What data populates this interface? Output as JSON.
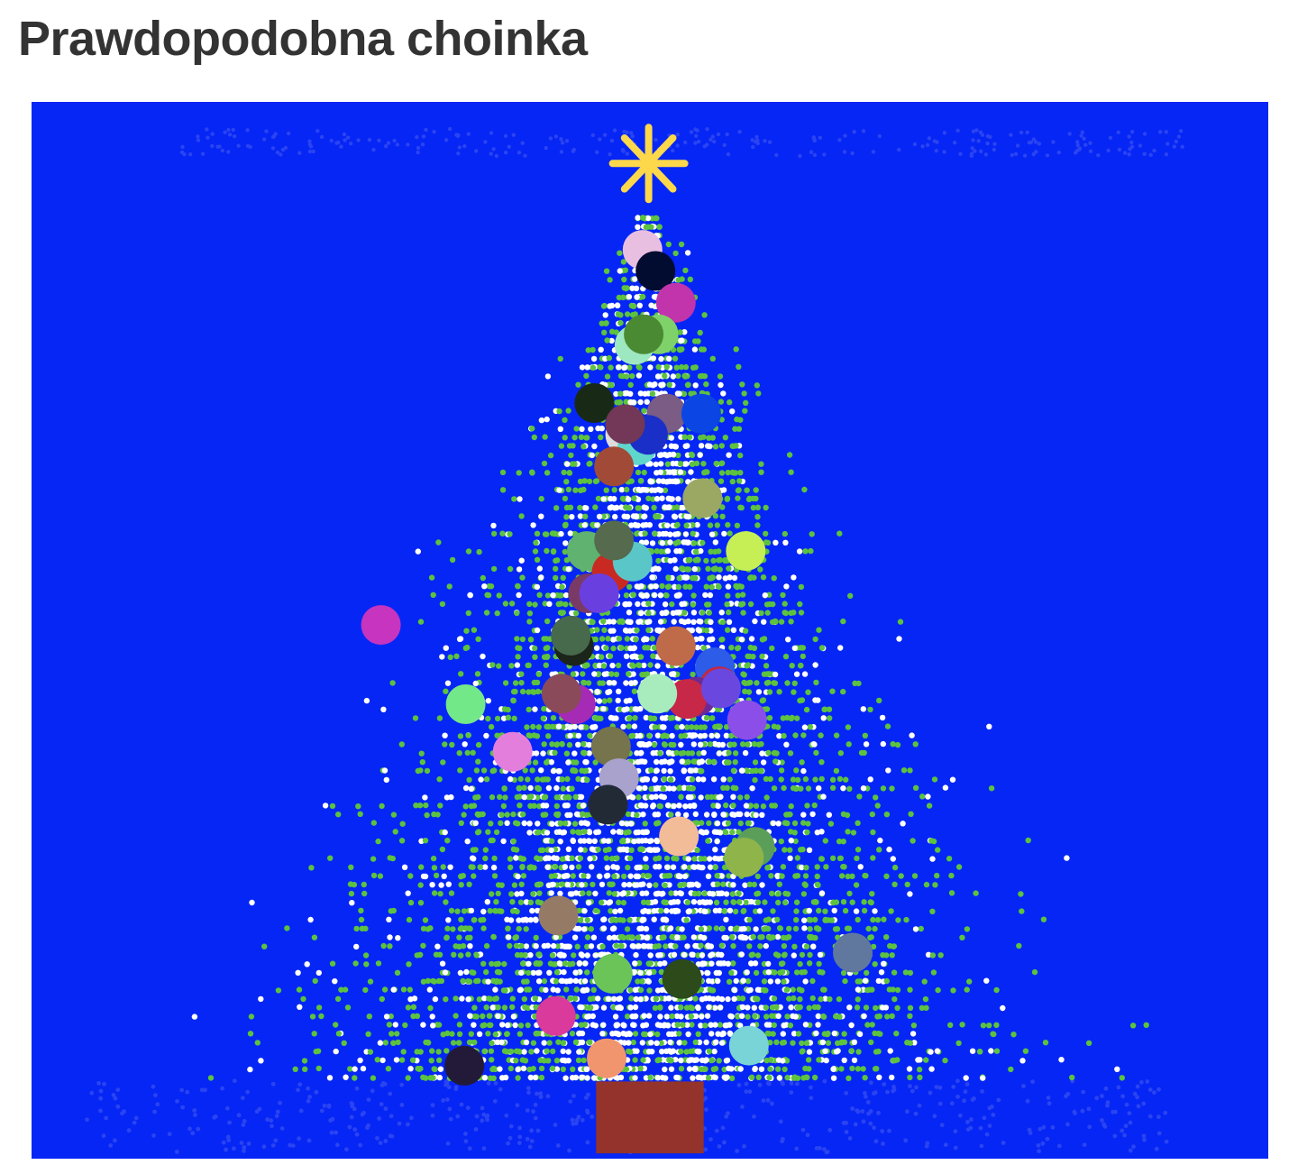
{
  "page": {
    "title": "Prawdopodobna choinka"
  },
  "chart_data": {
    "type": "scatter",
    "title": "Prawdopodobna choinka",
    "xlabel": "",
    "ylabel": "",
    "xlim": [
      -1,
      1
    ],
    "ylim": [
      0,
      1
    ],
    "grid": false,
    "axes_visible": false,
    "legend": "none",
    "colors": {
      "background": "#0626f5",
      "needles_green": "#5cc23f",
      "needles_white": "#ffffff",
      "snow_faint": "#2a44f2",
      "trunk": "#93332c",
      "star": "#fdd84a"
    },
    "tree": {
      "tip_y": 0.9,
      "base_y": 0.075,
      "half_width_at_base": 0.52,
      "spread": 0.9
    },
    "trunk": {
      "x": [
        -0.087,
        0.087
      ],
      "y": [
        0.005,
        0.073
      ]
    },
    "star": {
      "x": -0.002,
      "y": 0.94
    },
    "ornaments": [
      {
        "x": -0.012,
        "y": 0.86,
        "color": "#e8bfe0"
      },
      {
        "x": 0.009,
        "y": 0.84,
        "color": "#020b30"
      },
      {
        "x": 0.042,
        "y": 0.81,
        "color": "#c234ac"
      },
      {
        "x": 0.014,
        "y": 0.78,
        "color": "#7fd26a"
      },
      {
        "x": -0.025,
        "y": 0.77,
        "color": "#9de8c0"
      },
      {
        "x": -0.01,
        "y": 0.78,
        "color": "#4a8a32"
      },
      {
        "x": -0.09,
        "y": 0.715,
        "color": "#182a16"
      },
      {
        "x": 0.027,
        "y": 0.705,
        "color": "#7a5c84"
      },
      {
        "x": 0.083,
        "y": 0.705,
        "color": "#0b46e4"
      },
      {
        "x": -0.04,
        "y": 0.685,
        "color": "#dedcdc"
      },
      {
        "x": -0.02,
        "y": 0.675,
        "color": "#5fd6cc"
      },
      {
        "x": -0.003,
        "y": 0.685,
        "color": "#1a2ec8"
      },
      {
        "x": -0.04,
        "y": 0.695,
        "color": "#733757"
      },
      {
        "x": -0.058,
        "y": 0.655,
        "color": "#a24a38"
      },
      {
        "x": 0.085,
        "y": 0.625,
        "color": "#9aa864"
      },
      {
        "x": 0.155,
        "y": 0.575,
        "color": "#c6ef55"
      },
      {
        "x": -0.102,
        "y": 0.575,
        "color": "#5fb270"
      },
      {
        "x": -0.062,
        "y": 0.555,
        "color": "#c82a22"
      },
      {
        "x": -0.028,
        "y": 0.565,
        "color": "#5ac6c8"
      },
      {
        "x": -0.058,
        "y": 0.585,
        "color": "#566a4e"
      },
      {
        "x": -0.1,
        "y": 0.535,
        "color": "#7a3a66"
      },
      {
        "x": -0.082,
        "y": 0.535,
        "color": "#6a3fe0"
      },
      {
        "x": -0.123,
        "y": 0.485,
        "color": "#1b2519"
      },
      {
        "x": -0.128,
        "y": 0.495,
        "color": "#47694c"
      },
      {
        "x": 0.042,
        "y": 0.485,
        "color": "#bf6b4a"
      },
      {
        "x": 0.105,
        "y": 0.465,
        "color": "#2c5ce8"
      },
      {
        "x": 0.112,
        "y": 0.447,
        "color": "#c02a44"
      },
      {
        "x": 0.075,
        "y": 0.437,
        "color": "#6c2a94"
      },
      {
        "x": 0.06,
        "y": 0.435,
        "color": "#c82848"
      },
      {
        "x": 0.115,
        "y": 0.445,
        "color": "#6a48e0"
      },
      {
        "x": 0.012,
        "y": 0.44,
        "color": "#a8ecbe"
      },
      {
        "x": -0.12,
        "y": 0.43,
        "color": "#a52ab5"
      },
      {
        "x": -0.143,
        "y": 0.44,
        "color": "#8a4a5a"
      },
      {
        "x": -0.298,
        "y": 0.43,
        "color": "#73e889"
      },
      {
        "x": -0.435,
        "y": 0.505,
        "color": "#c634c0"
      },
      {
        "x": 0.157,
        "y": 0.415,
        "color": "#8b4ee8"
      },
      {
        "x": -0.222,
        "y": 0.385,
        "color": "#e47edc"
      },
      {
        "x": -0.063,
        "y": 0.39,
        "color": "#76744c"
      },
      {
        "x": -0.05,
        "y": 0.36,
        "color": "#a8a2cc"
      },
      {
        "x": -0.068,
        "y": 0.335,
        "color": "#222a36"
      },
      {
        "x": 0.047,
        "y": 0.305,
        "color": "#f3bc98"
      },
      {
        "x": 0.17,
        "y": 0.295,
        "color": "#5a9e5a"
      },
      {
        "x": 0.152,
        "y": 0.285,
        "color": "#8eb44a"
      },
      {
        "x": -0.148,
        "y": 0.23,
        "color": "#957a66"
      },
      {
        "x": 0.328,
        "y": 0.195,
        "color": "#60789e"
      },
      {
        "x": -0.06,
        "y": 0.175,
        "color": "#6ac458"
      },
      {
        "x": 0.052,
        "y": 0.17,
        "color": "#2c4a1a"
      },
      {
        "x": -0.152,
        "y": 0.135,
        "color": "#d93a9c"
      },
      {
        "x": 0.16,
        "y": 0.107,
        "color": "#78d4d6"
      },
      {
        "x": -0.07,
        "y": 0.095,
        "color": "#f0956e"
      },
      {
        "x": -0.3,
        "y": 0.088,
        "color": "#231a3a"
      }
    ]
  }
}
